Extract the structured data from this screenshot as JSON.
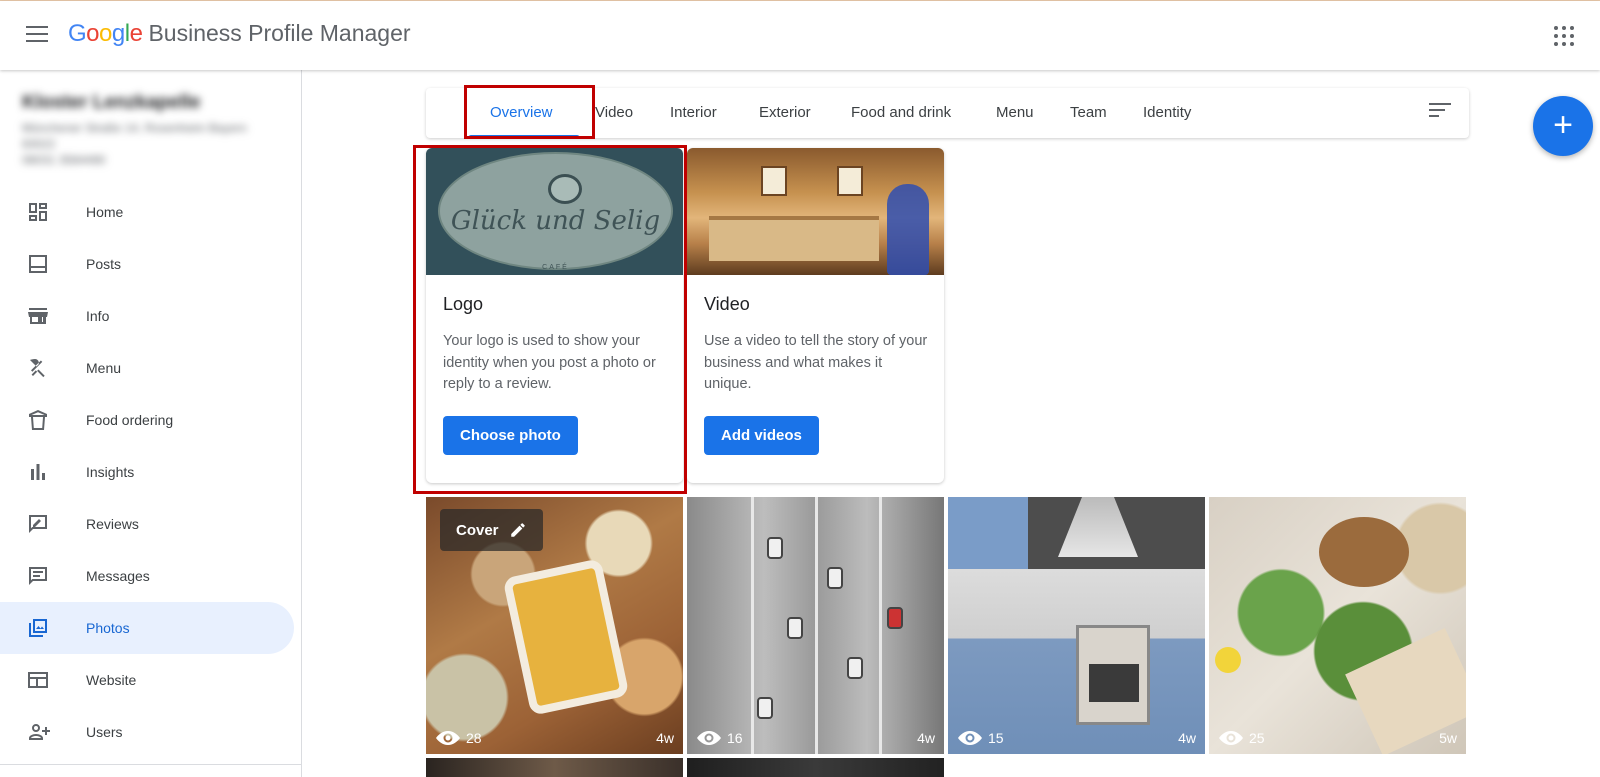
{
  "header": {
    "logo_letters": [
      {
        "ch": "G",
        "color": "#4285F4"
      },
      {
        "ch": "o",
        "color": "#EA4335"
      },
      {
        "ch": "o",
        "color": "#FBBC05"
      },
      {
        "ch": "g",
        "color": "#4285F4"
      },
      {
        "ch": "l",
        "color": "#34A853"
      },
      {
        "ch": "e",
        "color": "#EA4335"
      }
    ],
    "product_name": "Business Profile Manager"
  },
  "business": {
    "name": "Kloster Lenzkapelle",
    "address_line1": "Münchener Straße 14, Rosenheim Bayern",
    "address_line2": "83022",
    "phone": "08031 3584490"
  },
  "nav": [
    {
      "icon": "dashboard-icon",
      "label": "Home",
      "active": false
    },
    {
      "icon": "posts-icon",
      "label": "Posts",
      "active": false
    },
    {
      "icon": "storefront-icon",
      "label": "Info",
      "active": false
    },
    {
      "icon": "utensils-icon",
      "label": "Menu",
      "active": false
    },
    {
      "icon": "food-ordering-icon",
      "label": "Food ordering",
      "active": false
    },
    {
      "icon": "bar-chart-icon",
      "label": "Insights",
      "active": false
    },
    {
      "icon": "review-icon",
      "label": "Reviews",
      "active": false
    },
    {
      "icon": "message-icon",
      "label": "Messages",
      "active": false
    },
    {
      "icon": "photo-library-icon",
      "label": "Photos",
      "active": true
    },
    {
      "icon": "web-icon",
      "label": "Website",
      "active": false
    },
    {
      "icon": "person-add-icon",
      "label": "Users",
      "active": false
    }
  ],
  "tabs": [
    {
      "label": "Overview",
      "active": true
    },
    {
      "label": "Video",
      "active": false
    },
    {
      "label": "Interior",
      "active": false
    },
    {
      "label": "Exterior",
      "active": false
    },
    {
      "label": "Food and drink",
      "active": false
    },
    {
      "label": "Menu",
      "active": false
    },
    {
      "label": "Team",
      "active": false
    },
    {
      "label": "Identity",
      "active": false
    }
  ],
  "cards": {
    "logo": {
      "title": "Logo",
      "description": "Your logo is used to show your identity when you post a photo or reply to a review.",
      "button": "Choose photo",
      "brand_text": "Glück und Selig",
      "brand_sub": "CAFÉ"
    },
    "video": {
      "title": "Video",
      "description": "Use a video to tell the story of your business and what makes it unique.",
      "button": "Add videos"
    }
  },
  "photos": [
    {
      "views": "28",
      "age": "4w",
      "cover_label": "Cover"
    },
    {
      "views": "16",
      "age": "4w"
    },
    {
      "views": "15",
      "age": "4w"
    },
    {
      "views": "25",
      "age": "5w"
    }
  ],
  "fab": {
    "label": "+"
  },
  "colors": {
    "accent": "#1a73e8",
    "active_nav_bg": "#e8f0fe",
    "highlight": "#c00000"
  }
}
